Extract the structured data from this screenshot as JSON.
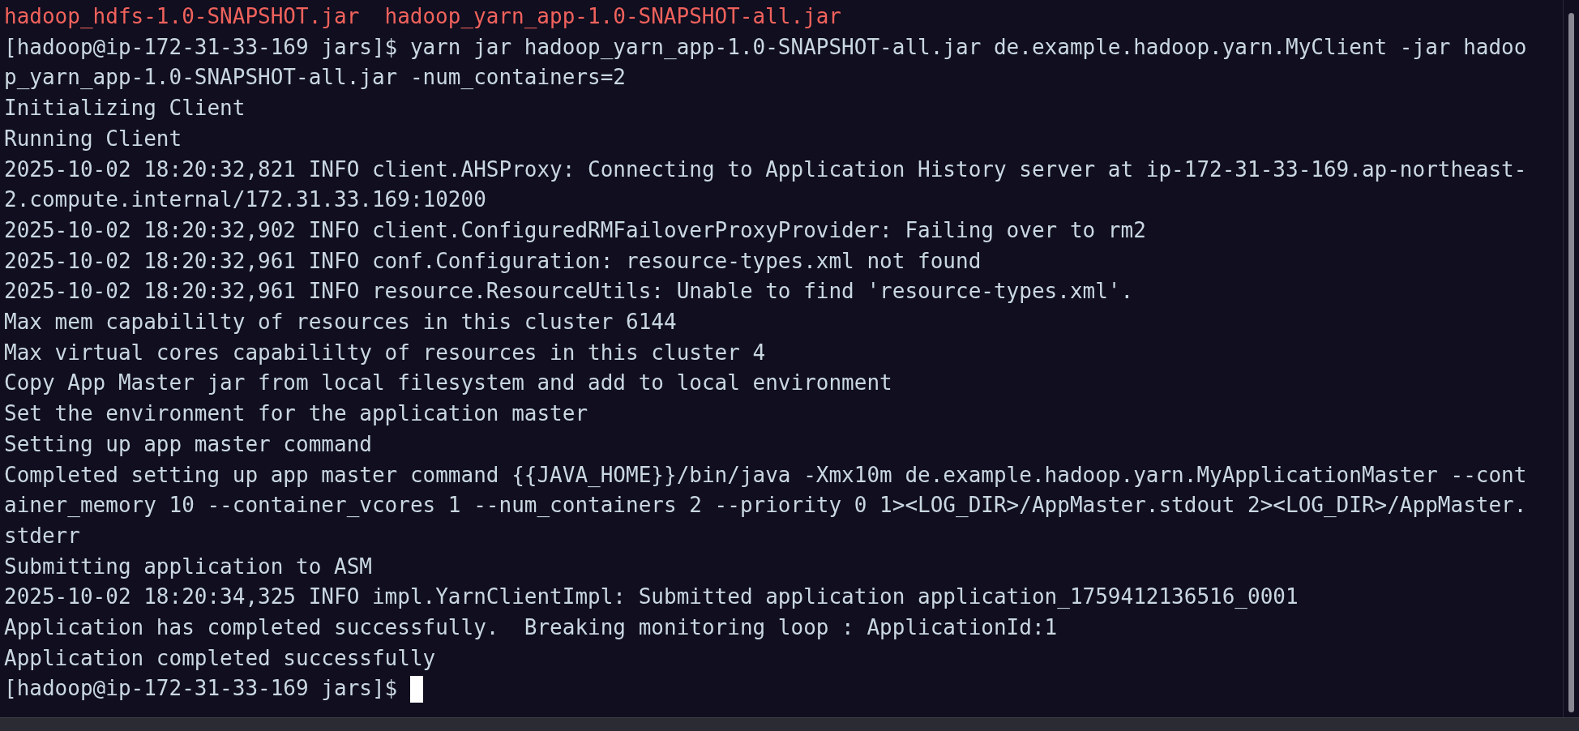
{
  "terminal": {
    "files": [
      "hadoop_hdfs-1.0-SNAPSHOT.jar",
      "hadoop_yarn_app-1.0-SNAPSHOT-all.jar"
    ],
    "lines": [
      "[hadoop@ip-172-31-33-169 jars]$ yarn jar hadoop_yarn_app-1.0-SNAPSHOT-all.jar de.example.hadoop.yarn.MyClient -jar hadoo",
      "p_yarn_app-1.0-SNAPSHOT-all.jar -num_containers=2",
      "Initializing Client",
      "Running Client",
      "2025-10-02 18:20:32,821 INFO client.AHSProxy: Connecting to Application History server at ip-172-31-33-169.ap-northeast-",
      "2.compute.internal/172.31.33.169:10200",
      "2025-10-02 18:20:32,902 INFO client.ConfiguredRMFailoverProxyProvider: Failing over to rm2",
      "2025-10-02 18:20:32,961 INFO conf.Configuration: resource-types.xml not found",
      "2025-10-02 18:20:32,961 INFO resource.ResourceUtils: Unable to find 'resource-types.xml'.",
      "Max mem capabililty of resources in this cluster 6144",
      "Max virtual cores capabililty of resources in this cluster 4",
      "Copy App Master jar from local filesystem and add to local environment",
      "Set the environment for the application master",
      "Setting up app master command",
      "Completed setting up app master command {{JAVA_HOME}}/bin/java -Xmx10m de.example.hadoop.yarn.MyApplicationMaster --cont",
      "ainer_memory 10 --container_vcores 1 --num_containers 2 --priority 0 1><LOG_DIR>/AppMaster.stdout 2><LOG_DIR>/AppMaster.",
      "stderr",
      "Submitting application to ASM",
      "2025-10-02 18:20:34,325 INFO impl.YarnClientImpl: Submitted application application_1759412136516_0001",
      "Application has completed successfully.  Breaking monitoring loop : ApplicationId:1",
      "Application completed successfully"
    ],
    "prompt": {
      "text": "[hadoop@ip-172-31-33-169 jars]$ ",
      "cursor": true
    }
  }
}
